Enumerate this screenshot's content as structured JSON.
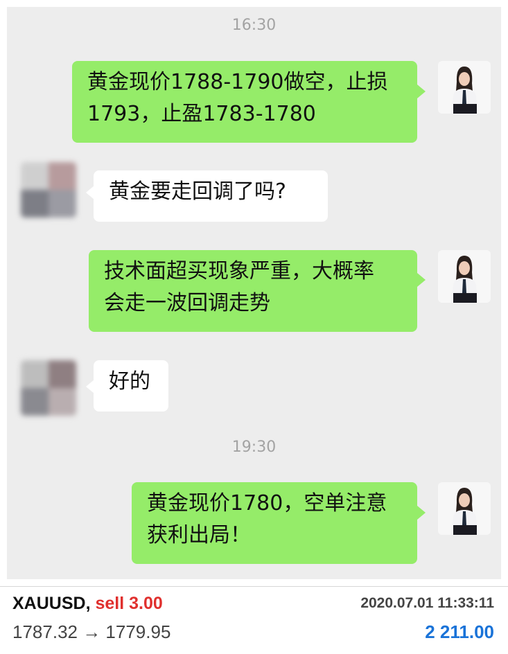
{
  "chat": {
    "timestamps": [
      "16:30",
      "19:30"
    ],
    "messages": [
      {
        "from": "agent",
        "text_line1": "黄金现价1788-1790做空，止损",
        "text_line2": "1793，止盈1783-1780"
      },
      {
        "from": "user",
        "text": "黄金要走回调了吗?"
      },
      {
        "from": "agent",
        "text_line1": "技术面超买现象严重，大概率",
        "text_line2": "会走一波回调走势"
      },
      {
        "from": "user",
        "text": "好的"
      },
      {
        "from": "agent",
        "text_line1": "黄金现价1780，空单注意",
        "text_line2": "获利出局！"
      }
    ],
    "bubble_colors": {
      "outgoing": "#95ec69",
      "incoming": "#ffffff"
    }
  },
  "trade": {
    "symbol": "XAUUSD,",
    "action": "sell 3.00",
    "datetime": "2020.07.01 11:33:11",
    "prices": "1787.32 → 1779.95",
    "profit": "2 211.00",
    "colors": {
      "sell": "#e0302e",
      "profit": "#1a73d8"
    }
  }
}
